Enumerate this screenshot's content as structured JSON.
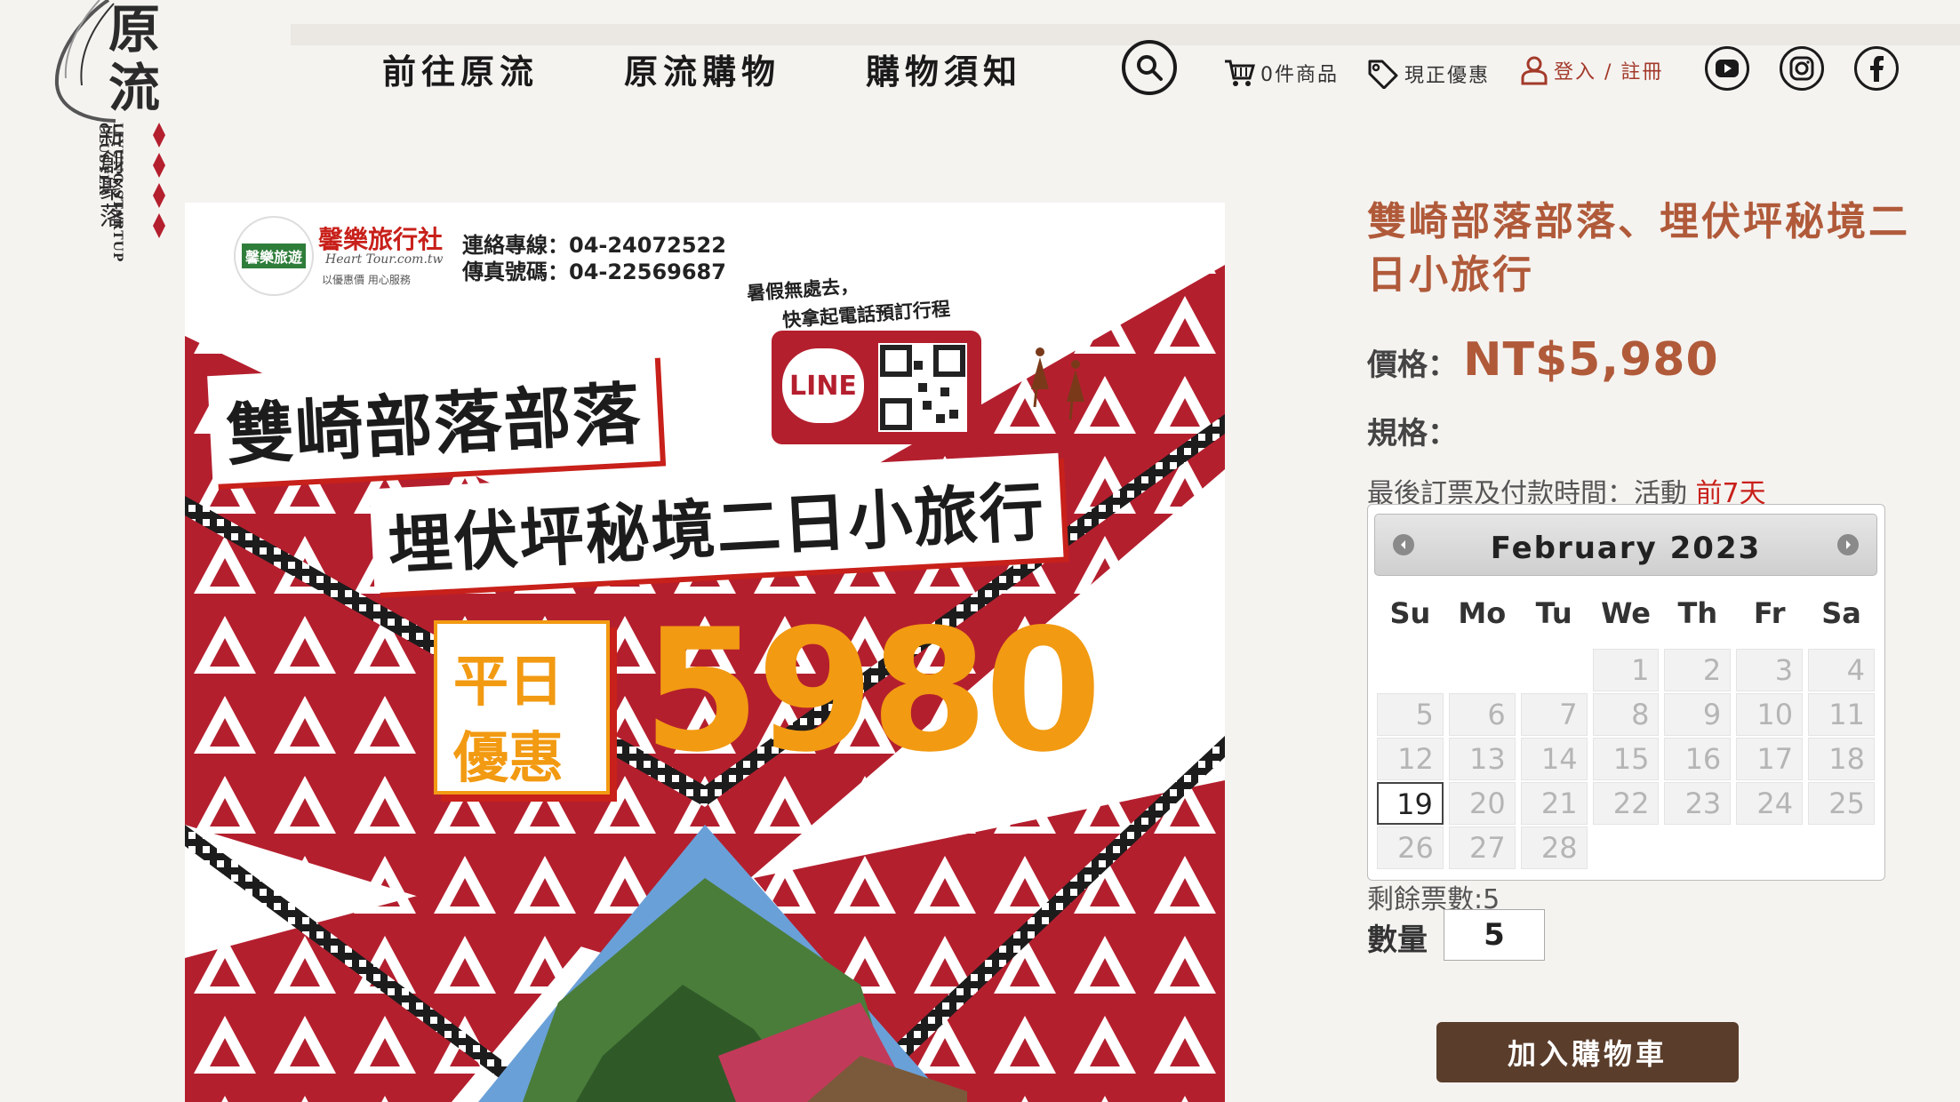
{
  "logo": {
    "main_text": "原流",
    "sub_text": "新創聚落",
    "en_text": "LIYUNG STARTUP CLUSTER"
  },
  "nav": {
    "items": [
      "前往原流",
      "原流購物",
      "購物須知"
    ]
  },
  "header": {
    "cart_label": "0件商品",
    "promo_label": "現正優惠",
    "login_label": "登入 / 註冊",
    "icons": [
      "search-icon",
      "cart-icon",
      "tag-icon",
      "user-icon",
      "youtube-icon",
      "instagram-icon",
      "facebook-icon"
    ]
  },
  "poster": {
    "agency_name": "馨樂旅行社",
    "agency_url": "Heart Tour.com.tw",
    "agency_tagline": "以優惠價 用心服務",
    "badge_text": "馨樂旅遊",
    "phone_line": "連絡專線：04-24072522",
    "fax_line": "傳真號碼：04-22569687",
    "callout_1": "暑假無處去，",
    "callout_2": "快拿起電話預訂行程",
    "line_label": "LINE",
    "headline_1": "雙崎部落部落",
    "headline_2": "埋伏坪秘境二日小旅行",
    "promo_tag_1": "平日",
    "promo_tag_2": "優惠",
    "promo_price": "5980",
    "colors": {
      "red": "#b41f2e",
      "orange": "#f29a12",
      "dark": "#1c1c1c"
    }
  },
  "product": {
    "title": "雙崎部落部落、埋伏坪秘境二日小旅行",
    "price_label": "價格：",
    "price_value": "NT$5,980",
    "spec_label": "規格：",
    "deadline_prefix": "最後訂票及付款時間：活動 ",
    "deadline_value": "前7天",
    "remaining": "剩餘票數:5",
    "qty_label": "數量",
    "qty_value": "5",
    "add_to_cart": "加入購物車"
  },
  "calendar": {
    "month_label": "February 2023",
    "weekdays": [
      "Su",
      "Mo",
      "Tu",
      "We",
      "Th",
      "Fr",
      "Sa"
    ],
    "leading_blanks": 3,
    "days": [
      "1",
      "2",
      "3",
      "4",
      "5",
      "6",
      "7",
      "8",
      "9",
      "10",
      "11",
      "12",
      "13",
      "14",
      "15",
      "16",
      "17",
      "18",
      "19",
      "20",
      "21",
      "22",
      "23",
      "24",
      "25",
      "26",
      "27",
      "28"
    ],
    "today": "19"
  }
}
